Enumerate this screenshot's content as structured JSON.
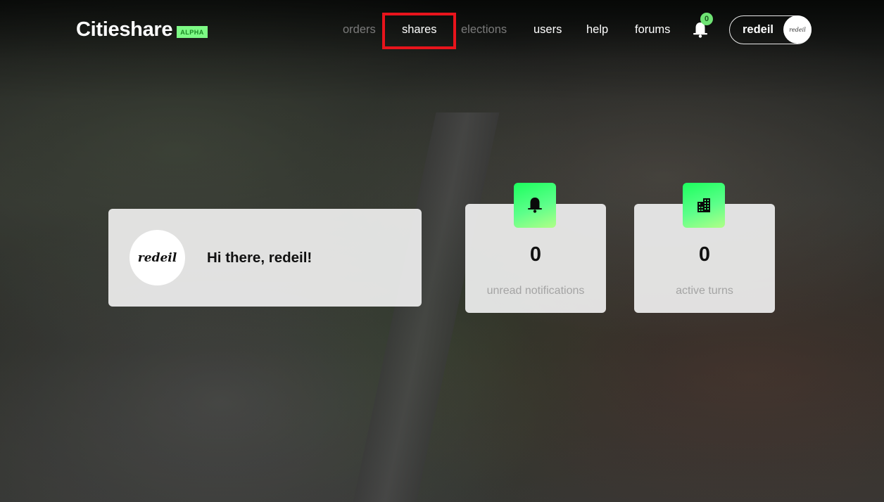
{
  "header": {
    "brand": "Citieshare",
    "badge": "ALPHA",
    "nav": [
      {
        "label": "orders",
        "state": "disabled"
      },
      {
        "label": "shares",
        "state": "active",
        "highlighted": true
      },
      {
        "label": "elections",
        "state": "disabled"
      },
      {
        "label": "users",
        "state": "enabled"
      },
      {
        "label": "help",
        "state": "enabled"
      },
      {
        "label": "forums",
        "state": "enabled"
      }
    ],
    "notifications": {
      "icon": "bell-icon",
      "count": "0"
    },
    "user": {
      "name": "redeil",
      "avatar_text": "redeil"
    }
  },
  "welcome": {
    "avatar_text": "redeil",
    "greeting": "Hi there, redeil!"
  },
  "stats": [
    {
      "icon": "bell-icon",
      "value": "0",
      "label": "unread notifications"
    },
    {
      "icon": "building-icon",
      "value": "0",
      "label": "active turns"
    }
  ],
  "colors": {
    "accent_green": "#7dfa85",
    "highlight_red": "#e8141c",
    "disabled_nav": "#7a7a7a"
  }
}
